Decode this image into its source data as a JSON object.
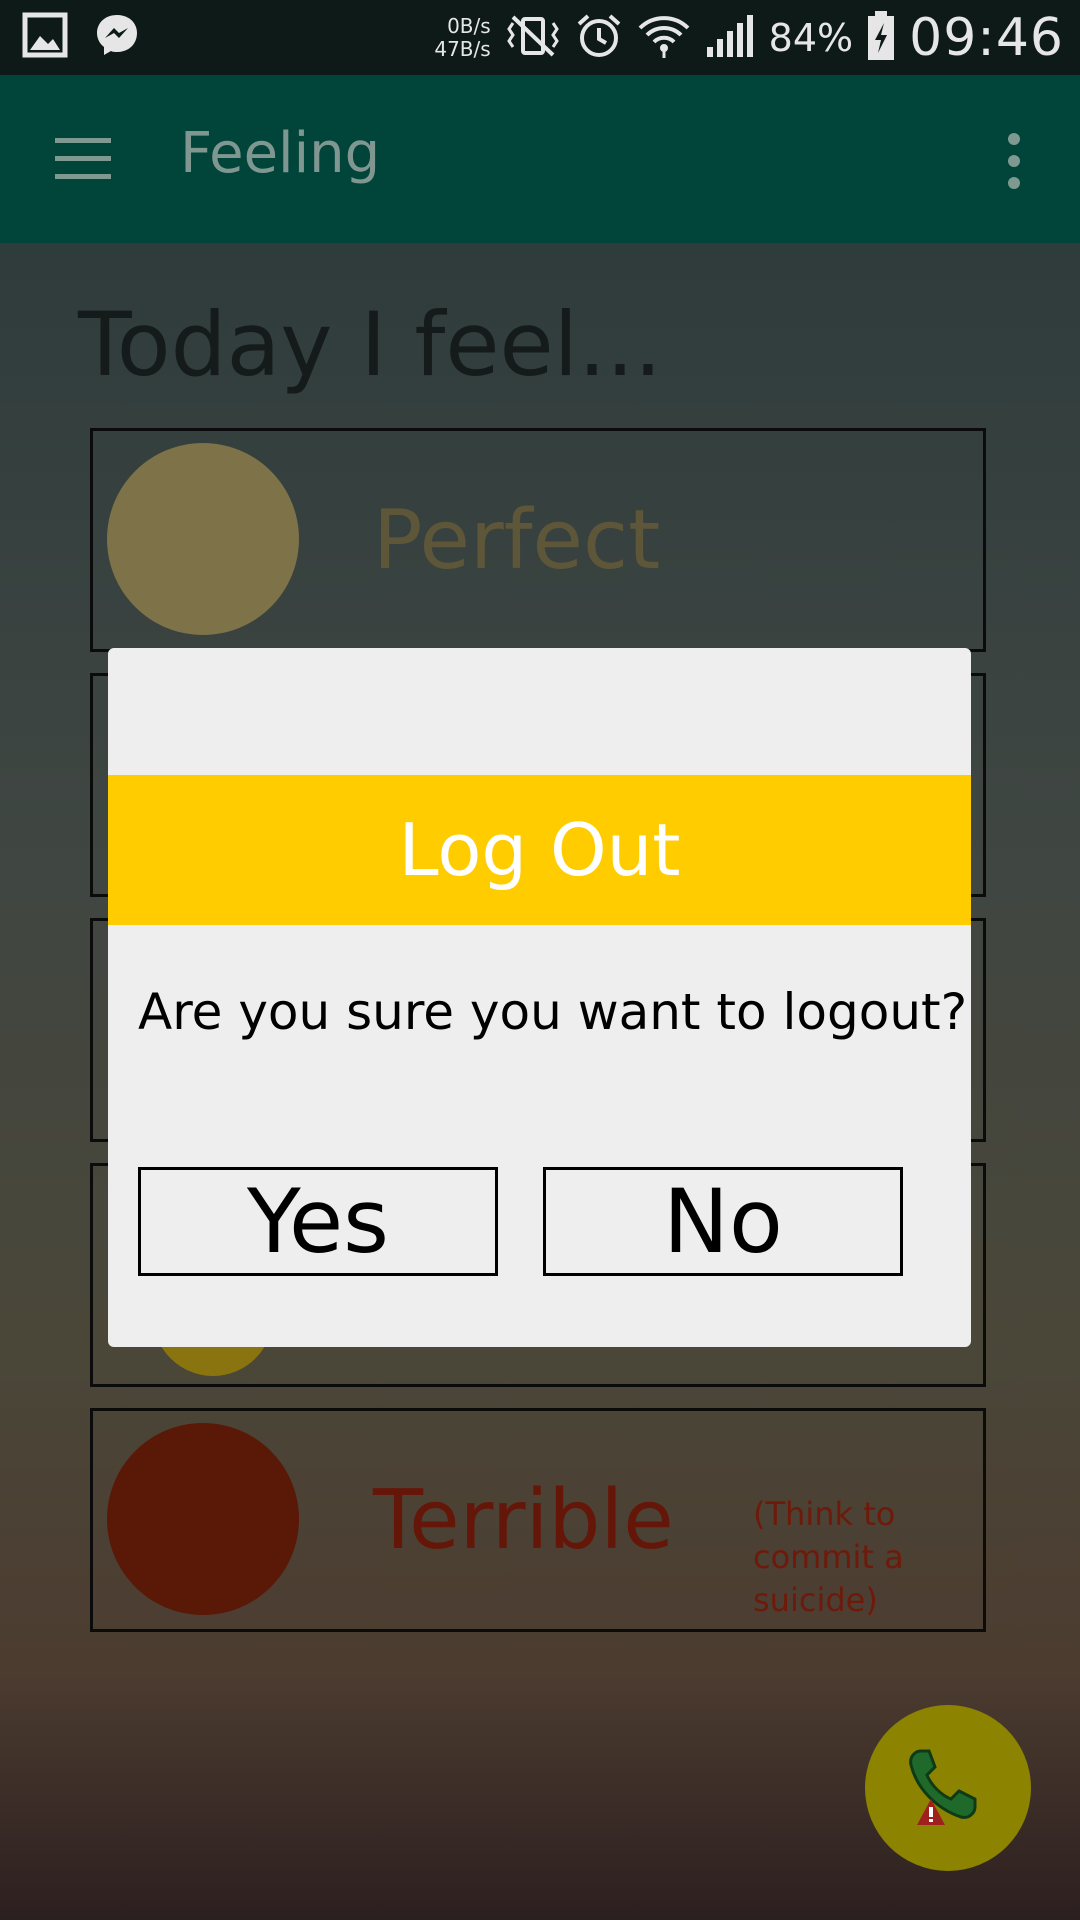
{
  "status_bar": {
    "net_down": "0B/s",
    "net_up": "47B/s",
    "battery": "84%",
    "time": "09:46",
    "icons": [
      "gallery-icon",
      "messenger-icon",
      "vibrate-icon",
      "alarm-icon",
      "wifi-icon",
      "signal-icon",
      "battery-charging-icon"
    ]
  },
  "app_bar": {
    "title": "Feeling",
    "icons": [
      "menu-icon",
      "more-vert-icon"
    ]
  },
  "main": {
    "heading": "Today I feel...",
    "moods": [
      {
        "label": "Perfect",
        "color": "#7d7248"
      },
      {
        "label": "Terrible",
        "note": "(Think to commit a suicide)",
        "color": "#5a1806"
      }
    ]
  },
  "fab": {
    "icon": "emergency-call-icon"
  },
  "dialog": {
    "title": "Log Out",
    "message": "Are you sure you want to logout?",
    "yes_label": "Yes",
    "no_label": "No",
    "accent": "#ffcc00"
  }
}
